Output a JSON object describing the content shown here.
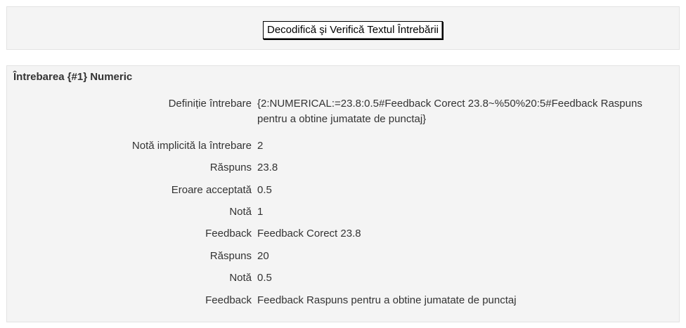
{
  "toolbar": {
    "decode_button_label": "Decodifică şi Verifică Textul Întrebării"
  },
  "question": {
    "heading": "Întrebarea {#1} Numeric",
    "rows": [
      {
        "label": "Definiție întrebare",
        "value": "{2:NUMERICAL:=23.8:0.5#Feedback Corect 23.8~%50%20:5#Feedback Raspuns pentru a obtine jumatate de punctaj}"
      },
      {
        "label": "Notă implicită la întrebare",
        "value": "2"
      },
      {
        "label": "Răspuns",
        "value": "23.8"
      },
      {
        "label": "Eroare acceptată",
        "value": "0.5"
      },
      {
        "label": "Notă",
        "value": "1"
      },
      {
        "label": "Feedback",
        "value": "Feedback Corect 23.8"
      },
      {
        "label": "Răspuns",
        "value": "20"
      },
      {
        "label": "Notă",
        "value": "0.5"
      },
      {
        "label": "Feedback",
        "value": "Feedback Raspuns pentru a obtine jumatate de punctaj"
      }
    ]
  }
}
